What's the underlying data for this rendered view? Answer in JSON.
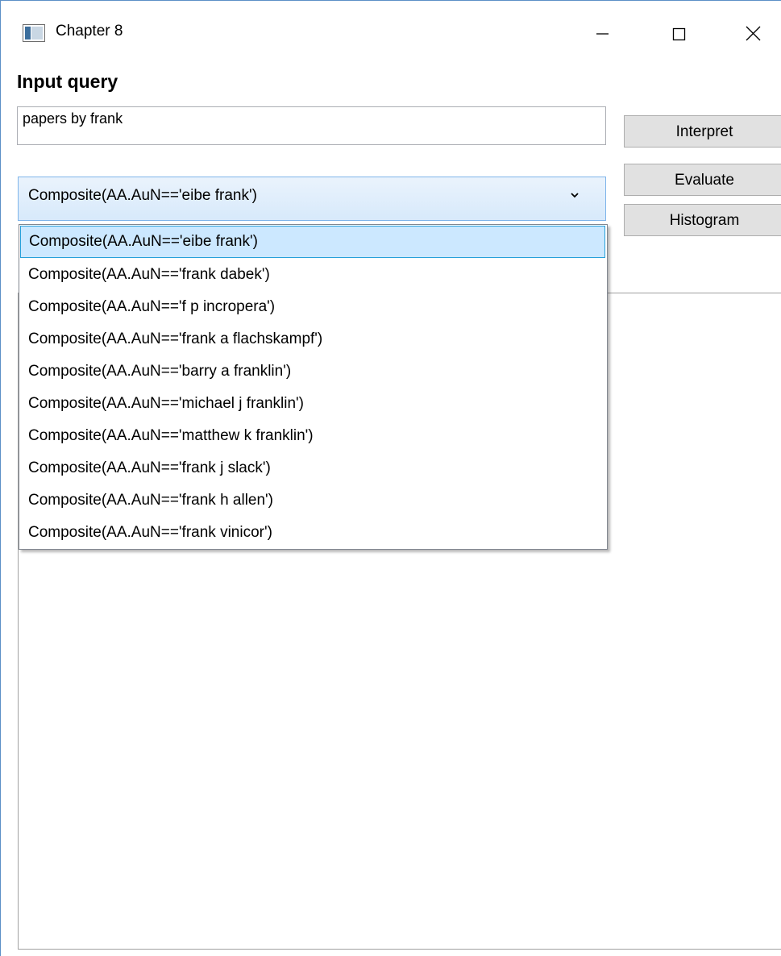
{
  "window": {
    "title": "Chapter 8",
    "controls": {
      "minimize": "—",
      "maximize": "☐",
      "close": "✕"
    }
  },
  "heading": "Input query",
  "query_input": {
    "value": "papers by frank"
  },
  "buttons": {
    "interpret": "Interpret",
    "evaluate": "Evaluate",
    "histogram": "Histogram"
  },
  "combo": {
    "selected": "Composite(AA.AuN=='eibe frank')"
  },
  "dropdown": {
    "items": [
      "Composite(AA.AuN=='eibe frank')",
      "Composite(AA.AuN=='frank dabek')",
      "Composite(AA.AuN=='f p incropera')",
      "Composite(AA.AuN=='frank a flachskampf')",
      "Composite(AA.AuN=='barry a franklin')",
      "Composite(AA.AuN=='michael j franklin')",
      "Composite(AA.AuN=='matthew k franklin')",
      "Composite(AA.AuN=='frank j slack')",
      "Composite(AA.AuN=='frank h allen')",
      "Composite(AA.AuN=='frank vinicor')"
    ],
    "selected_index": 0
  },
  "colors": {
    "accent": "#26a0da",
    "selection": "#cce8ff",
    "button": "#e1e1e1",
    "window_border": "#5b8fc7"
  },
  "icons": {
    "app": "app-window-icon",
    "combo_arrow": "chevron-down-icon"
  }
}
